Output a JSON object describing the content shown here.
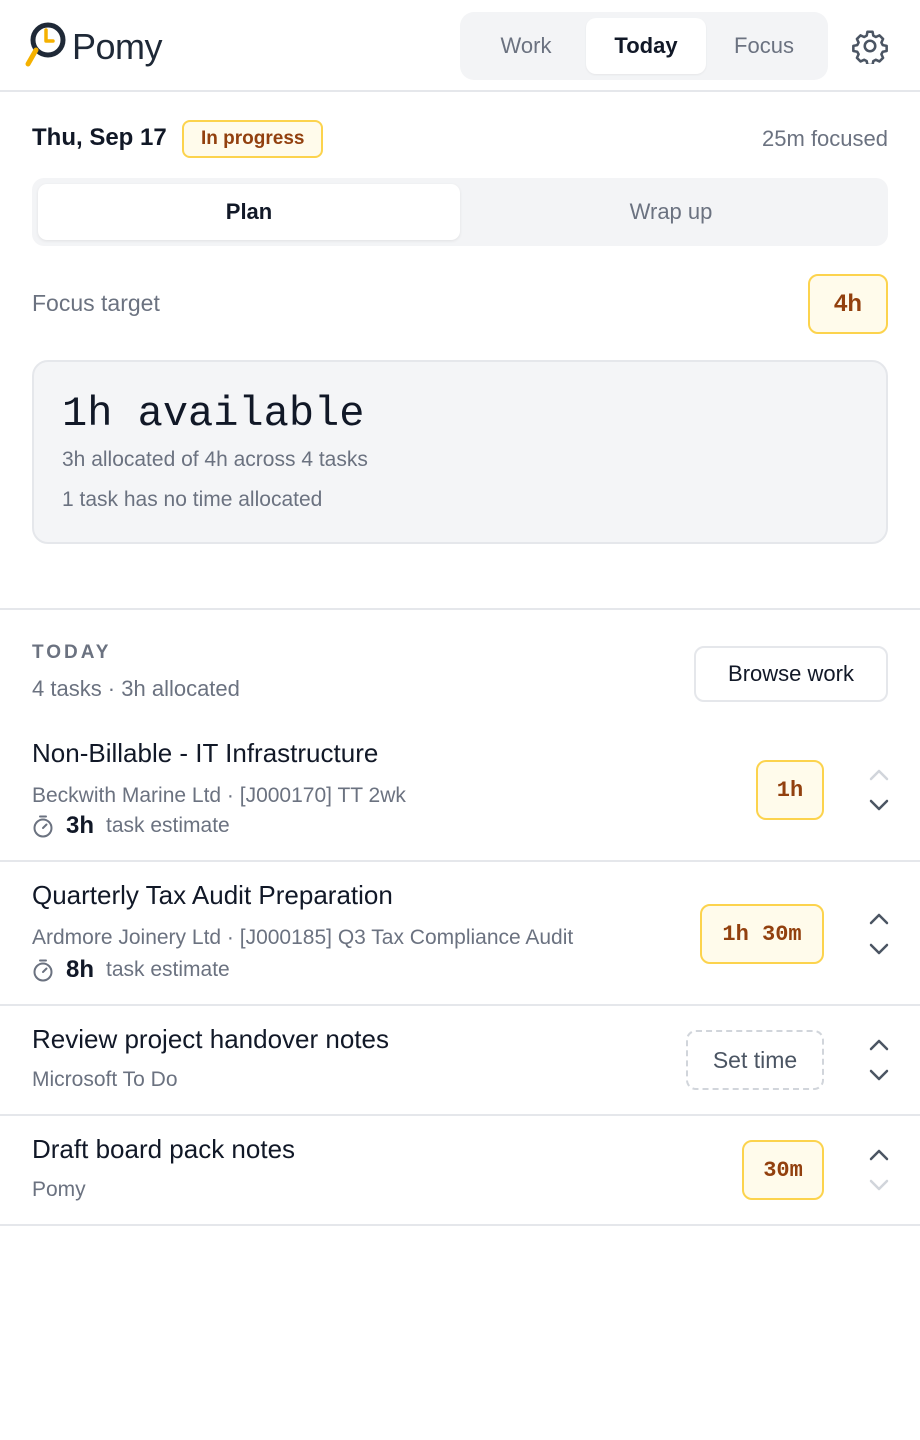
{
  "app": {
    "name": "Pomy"
  },
  "nav": {
    "tabs": [
      "Work",
      "Today",
      "Focus"
    ],
    "active": "Today"
  },
  "header": {
    "date": "Thu, Sep 17",
    "status": "In progress",
    "focused": "25m focused"
  },
  "mode": {
    "tabs": [
      "Plan",
      "Wrap up"
    ],
    "active": "Plan"
  },
  "focus_target": {
    "label": "Focus target",
    "value": "4h"
  },
  "summary": {
    "available": "1h available",
    "allocated": "3h allocated of 4h across 4 tasks",
    "unallocated": "1 task has no time allocated"
  },
  "today": {
    "label": "TODAY",
    "sub": "4 tasks · 3h allocated",
    "browse": "Browse work",
    "tasks": [
      {
        "title": "Non-Billable - IT Infrastructure",
        "sub": "Beckwith Marine Ltd · [J000170] TT 2wk",
        "estimate": "3h",
        "estimate_label": "task estimate",
        "allocated": "1h"
      },
      {
        "title": "Quarterly Tax Audit Preparation",
        "sub": "Ardmore Joinery Ltd · [J000185] Q3 Tax Compliance Audit",
        "estimate": "8h",
        "estimate_label": "task estimate",
        "allocated": "1h 30m"
      },
      {
        "title": "Review project handover notes",
        "sub": "Microsoft To Do",
        "allocated": "Set time"
      },
      {
        "title": "Draft board pack notes",
        "sub": "Pomy",
        "allocated": "30m"
      }
    ]
  },
  "colors": {
    "accent": "#f5b100",
    "badge_bg": "#fffbeb",
    "badge_border": "#fcd34d",
    "badge_text": "#92400e"
  }
}
